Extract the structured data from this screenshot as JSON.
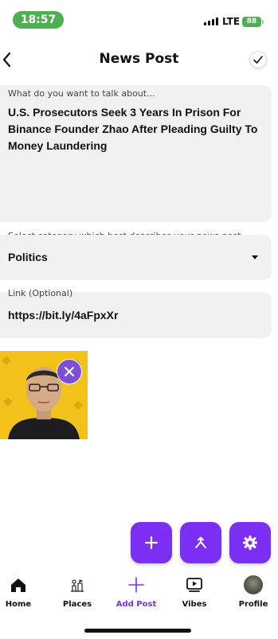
{
  "status": {
    "time": "18:57",
    "network": "LTE",
    "battery": "88"
  },
  "header": {
    "title": "News Post"
  },
  "topic": {
    "label": "What do you want to talk about...",
    "value": "U.S. Prosecutors Seek 3 Years In Prison For Binance Founder Zhao After Pleading Guilty To Money Laundering"
  },
  "category": {
    "label": "Select category which best describes your news post",
    "value": "Politics"
  },
  "link": {
    "label": "Link (Optional)",
    "value": "https://bit.ly/4aFpxXr"
  },
  "tabs": [
    {
      "label": "Home",
      "icon": "home-icon"
    },
    {
      "label": "Places",
      "icon": "places-icon"
    },
    {
      "label": "Add Post",
      "icon": "plus-icon"
    },
    {
      "label": "Vibes",
      "icon": "play-icon"
    },
    {
      "label": "Profile",
      "icon": "avatar"
    }
  ],
  "colors": {
    "accent": "#7b2ff2",
    "card": "#f1f1f1",
    "status_green": "#4caf50"
  }
}
